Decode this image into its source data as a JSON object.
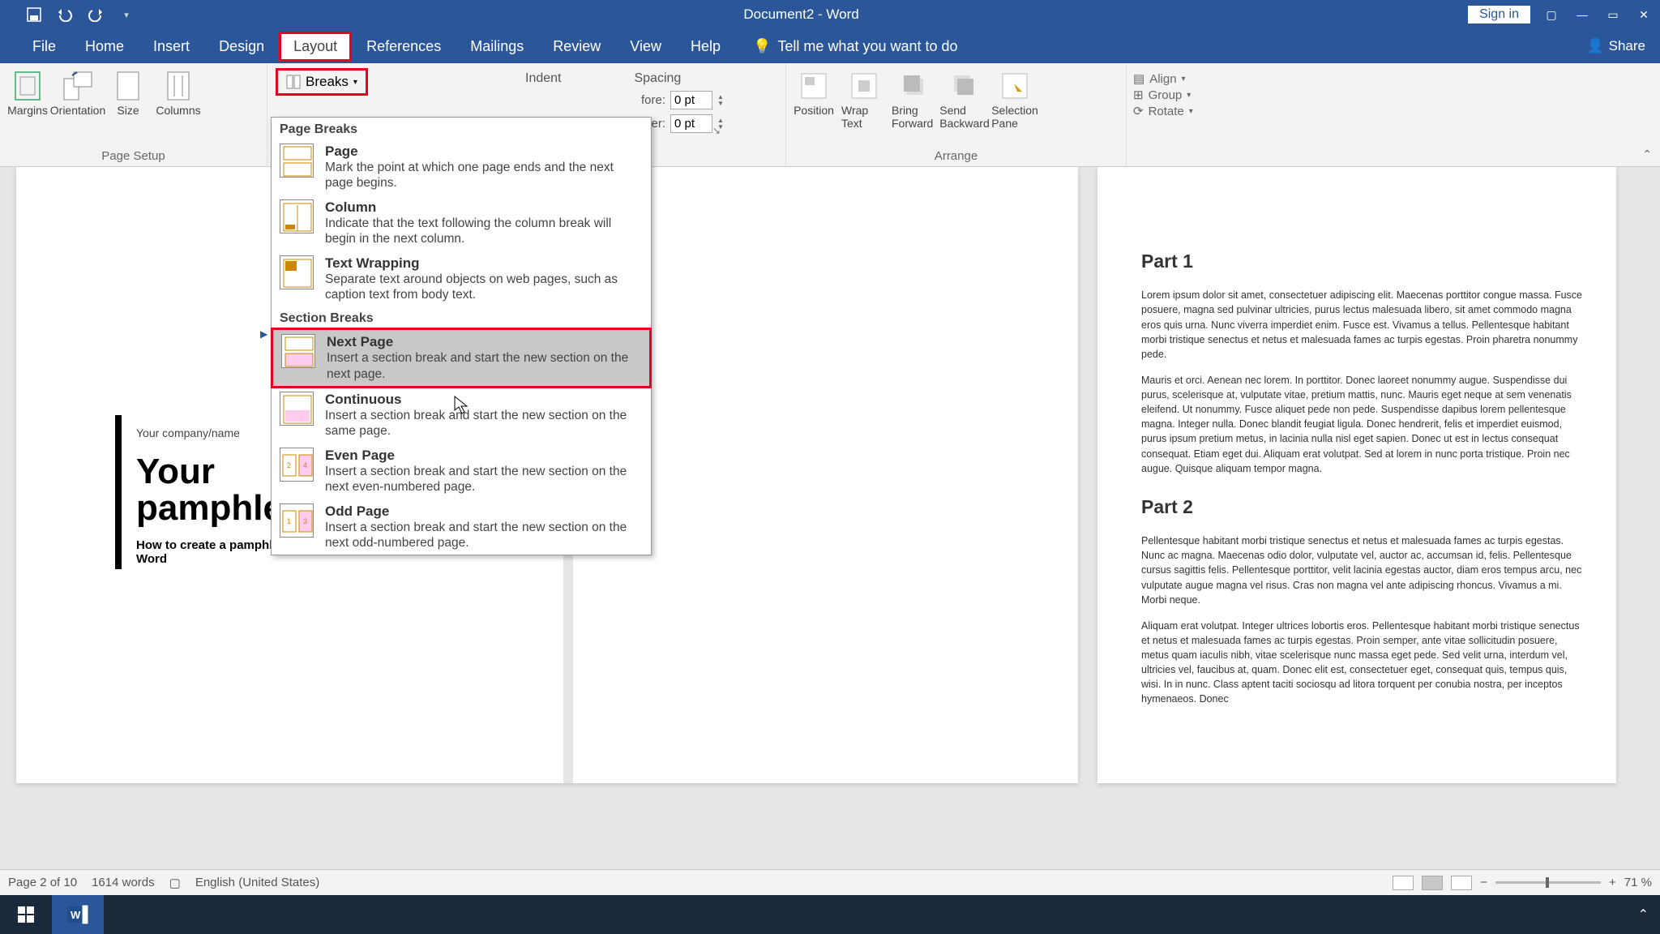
{
  "title": "Document2 - Word",
  "qat": {
    "save": "Save",
    "undo": "Undo",
    "redo": "Redo"
  },
  "title_actions": {
    "signin": "Sign in"
  },
  "menu": {
    "file": "File",
    "home": "Home",
    "insert": "Insert",
    "design": "Design",
    "layout": "Layout",
    "references": "References",
    "mailings": "Mailings",
    "review": "Review",
    "view": "View",
    "help": "Help",
    "tellme": "Tell me what you want to do",
    "share": "Share"
  },
  "ribbon": {
    "page_setup": {
      "label": "Page Setup",
      "margins": "Margins",
      "orientation": "Orientation",
      "size": "Size",
      "columns": "Columns",
      "breaks": "Breaks"
    },
    "paragraph": {
      "indent": "Indent",
      "spacing": "Spacing",
      "before_lbl": "fore:",
      "after_lbl": "ter:",
      "before_val": "0 pt",
      "after_val": "0 pt"
    },
    "arrange": {
      "label": "Arrange",
      "position": "Position",
      "wrap": "Wrap Text",
      "bring": "Bring Forward",
      "send": "Send Backward",
      "selection": "Selection Pane",
      "align": "Align",
      "group": "Group",
      "rotate": "Rotate"
    }
  },
  "breaks_menu": {
    "page_breaks": "Page Breaks",
    "section_breaks": "Section Breaks",
    "items": [
      {
        "title": "Page",
        "desc": "Mark the point at which one page ends and the next page begins."
      },
      {
        "title": "Column",
        "desc": "Indicate that the text following the column break will begin in the next column."
      },
      {
        "title": "Text Wrapping",
        "desc": "Separate text around objects on web pages, such as caption text from body text."
      },
      {
        "title": "Next Page",
        "desc": "Insert a section break and start the new section on the next page."
      },
      {
        "title": "Continuous",
        "desc": "Insert a section break and start the new section on the same page."
      },
      {
        "title": "Even Page",
        "desc": "Insert a section break and start the new section on the next even-numbered page."
      },
      {
        "title": "Odd Page",
        "desc": "Insert a section break and start the new section on the next odd-numbered page."
      }
    ]
  },
  "doc": {
    "company": "Your company/name",
    "title1": "Your",
    "title2": "pamphle",
    "subtitle": "How to create a pamphlet in Word",
    "part1": "Part 1",
    "part1_p1": "Lorem ipsum dolor sit amet, consectetuer adipiscing elit. Maecenas porttitor congue massa. Fusce posuere, magna sed pulvinar ultricies, purus lectus malesuada libero, sit amet commodo magna eros quis urna. Nunc viverra imperdiet enim. Fusce est. Vivamus a tellus. Pellentesque habitant morbi tristique senectus et netus et malesuada fames ac turpis egestas. Proin pharetra nonummy pede.",
    "part1_p2": "Mauris et orci. Aenean nec lorem. In porttitor. Donec laoreet nonummy augue. Suspendisse dui purus, scelerisque at, vulputate vitae, pretium mattis, nunc. Mauris eget neque at sem venenatis eleifend. Ut nonummy. Fusce aliquet pede non pede. Suspendisse dapibus lorem pellentesque magna. Integer nulla. Donec blandit feugiat ligula. Donec hendrerit, felis et imperdiet euismod, purus ipsum pretium metus, in lacinia nulla nisl eget sapien. Donec ut est in lectus consequat consequat. Etiam eget dui. Aliquam erat volutpat. Sed at lorem in nunc porta tristique. Proin nec augue. Quisque aliquam tempor magna.",
    "part2": "Part 2",
    "part2_p1": "Pellentesque habitant morbi tristique senectus et netus et malesuada fames ac turpis egestas. Nunc ac magna. Maecenas odio dolor, vulputate vel, auctor ac, accumsan id, felis. Pellentesque cursus sagittis felis. Pellentesque porttitor, velit lacinia egestas auctor, diam eros tempus arcu, nec vulputate augue magna vel risus. Cras non magna vel ante adipiscing rhoncus. Vivamus a mi. Morbi neque.",
    "part2_p2": "Aliquam erat volutpat. Integer ultrices lobortis eros. Pellentesque habitant morbi tristique senectus et netus et malesuada fames ac turpis egestas. Proin semper, ante vitae sollicitudin posuere, metus quam iaculis nibh, vitae scelerisque nunc massa eget pede. Sed velit urna, interdum vel, ultricies vel, faucibus at, quam. Donec elit est, consectetuer eget, consequat quis, tempus quis, wisi. In in nunc. Class aptent taciti sociosqu ad litora torquent per conubia nostra, per inceptos hymenaeos. Donec"
  },
  "status": {
    "page": "Page 2 of 10",
    "words": "1614 words",
    "lang": "English (United States)",
    "zoom": "71 %"
  }
}
